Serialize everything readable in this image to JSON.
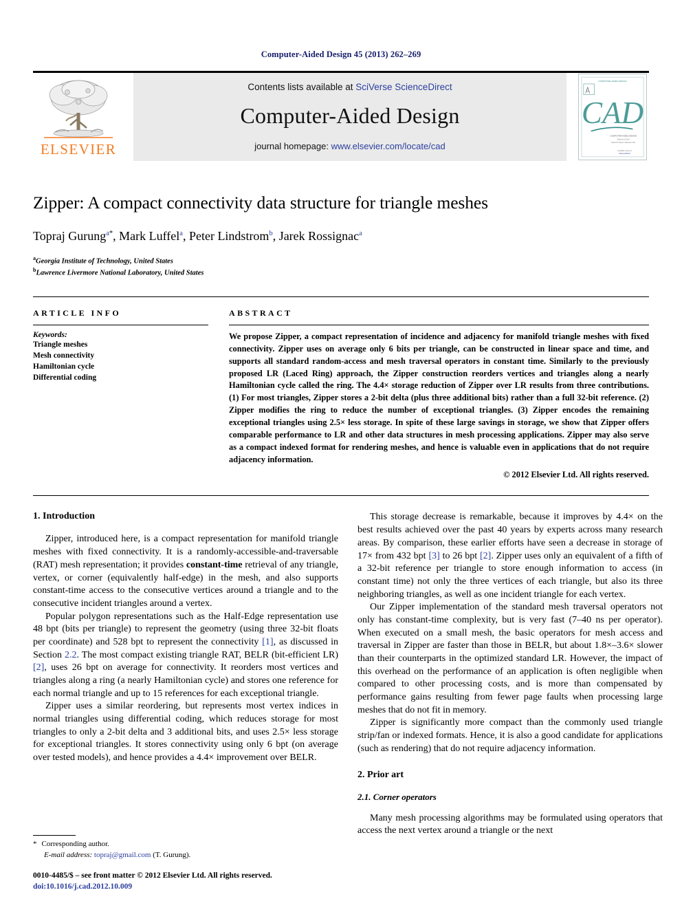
{
  "running_head": "Computer-Aided Design 45 (2013) 262–269",
  "masthead": {
    "contents_prefix": "Contents lists available at ",
    "contents_link": "SciVerse ScienceDirect",
    "journal_title": "Computer-Aided Design",
    "homepage_prefix": "journal homepage: ",
    "homepage_link": "www.elsevier.com/locate/cad",
    "publisher_wordmark": "ELSEVIER",
    "publisher_color": "#f47b20",
    "cover_title": "CAD",
    "cover_color": "#2e8b87",
    "cover_subtitle": "COMPUTER-AIDED DESIGN",
    "cover_editors": "Editors-in-Chief:\nDavid W. Rosen / Ramesh K. Jain"
  },
  "title": "Zipper: A compact connectivity data structure for triangle meshes",
  "authors": [
    {
      "name": "Topraj Gurung",
      "sup": "a",
      "star": true
    },
    {
      "name": "Mark Luffel",
      "sup": "a",
      "star": false
    },
    {
      "name": "Peter Lindstrom",
      "sup": "b",
      "star": false
    },
    {
      "name": "Jarek Rossignac",
      "sup": "a",
      "star": false
    }
  ],
  "affiliations": [
    {
      "mark": "a",
      "text": "Georgia Institute of Technology, United States"
    },
    {
      "mark": "b",
      "text": "Lawrence Livermore National Laboratory, United States"
    }
  ],
  "article_info": {
    "heading": "ARTICLE INFO",
    "keywords_label": "Keywords:",
    "keywords": [
      "Triangle meshes",
      "Mesh connectivity",
      "Hamiltonian cycle",
      "Differential coding"
    ]
  },
  "abstract": {
    "heading": "ABSTRACT",
    "text": "We propose Zipper, a compact representation of incidence and adjacency for manifold triangle meshes with fixed connectivity. Zipper uses on average only 6 bits per triangle, can be constructed in linear space and time, and supports all standard random-access and mesh traversal operators in constant time. Similarly to the previously proposed LR (Laced Ring) approach, the Zipper construction reorders vertices and triangles along a nearly Hamiltonian cycle called the ring. The 4.4× storage reduction of Zipper over LR results from three contributions. (1) For most triangles, Zipper stores a 2-bit delta (plus three additional bits) rather than a full 32-bit reference. (2) Zipper modifies the ring to reduce the number of exceptional triangles. (3) Zipper encodes the remaining exceptional triangles using 2.5× less storage. In spite of these large savings in storage, we show that Zipper offers comparable performance to LR and other data structures in mesh processing applications. Zipper may also serve as a compact indexed format for rendering meshes, and hence is valuable even in applications that do not require adjacency information.",
    "copyright": "© 2012 Elsevier Ltd. All rights reserved."
  },
  "sections": {
    "intro_heading": "1. Introduction",
    "prior_art_heading": "2. Prior art",
    "corner_ops_heading": "2.1. Corner operators"
  },
  "left_column": {
    "p1_a": "Zipper, introduced here, is a compact representation for manifold triangle meshes with fixed connectivity. It is a randomly-accessible-and-traversable (RAT) mesh representation; it provides ",
    "p1_bold": "constant-time",
    "p1_b": " retrieval of any triangle, vertex, or corner (equivalently half-edge) in the mesh, and also supports constant-time access to the consecutive vertices around a triangle and to the consecutive incident triangles around a vertex.",
    "p2_a": "Popular polygon representations such as the Half-Edge representation use 48 bpt (bits per triangle) to represent the geometry (using three 32-bit floats per coordinate) and 528 bpt to represent the connectivity ",
    "p2_cite1": "[1]",
    "p2_b": ", as discussed in Section ",
    "p2_secref": "2.2",
    "p2_c": ". The most compact existing triangle RAT, BELR (bit-efficient LR) ",
    "p2_cite2": "[2]",
    "p2_d": ", uses 26 bpt on average for connectivity. It reorders most vertices and triangles along a ring (a nearly Hamiltonian cycle) and stores one reference for each normal triangle and up to 15 references for each exceptional triangle.",
    "p3": "Zipper uses a similar reordering, but represents most vertex indices in normal triangles using differential coding, which reduces storage for most triangles to only a 2-bit delta and 3 additional bits, and uses 2.5× less storage for exceptional triangles. It stores connectivity using only 6 bpt (on average over tested models), and hence provides a 4.4× improvement over BELR."
  },
  "right_column": {
    "p1_a": "This storage decrease is remarkable, because it improves by 4.4× on the best results achieved over the past 40 years by experts across many research areas. By comparison, these earlier efforts have seen a decrease in storage of 17× from 432 bpt ",
    "p1_cite3": "[3]",
    "p1_b": " to 26 bpt ",
    "p1_cite2": "[2]",
    "p1_c": ". Zipper uses only an equivalent of a fifth of a 32-bit reference per triangle to store enough information to access (in constant time) not only the three vertices of each triangle, but also its three neighboring triangles, as well as one incident triangle for each vertex.",
    "p2": "Our Zipper implementation of the standard mesh traversal operators not only has constant-time complexity, but is very fast (7–40 ns per operator). When executed on a small mesh, the basic operators for mesh access and traversal in Zipper are faster than those in BELR, but about 1.8×–3.6× slower than their counterparts in the optimized standard LR. However, the impact of this overhead on the performance of an application is often negligible when compared to other processing costs, and is more than compensated by performance gains resulting from fewer page faults when processing large meshes that do not fit in memory.",
    "p3": "Zipper is significantly more compact than the commonly used triangle strip/fan or indexed formats. Hence, it is also a good candidate for applications (such as rendering) that do not require adjacency information.",
    "p4": "Many mesh processing algorithms may be formulated using operators that access the next vertex around a triangle or the next"
  },
  "footnote": {
    "star": "*",
    "corresponding": "Corresponding author.",
    "email_label": "E-mail address:",
    "email": "topraj@gmail.com",
    "email_owner": "(T. Gurung).",
    "issn_line": "0010-4485/$ – see front matter © 2012 Elsevier Ltd. All rights reserved.",
    "doi": "doi:10.1016/j.cad.2012.10.009"
  }
}
